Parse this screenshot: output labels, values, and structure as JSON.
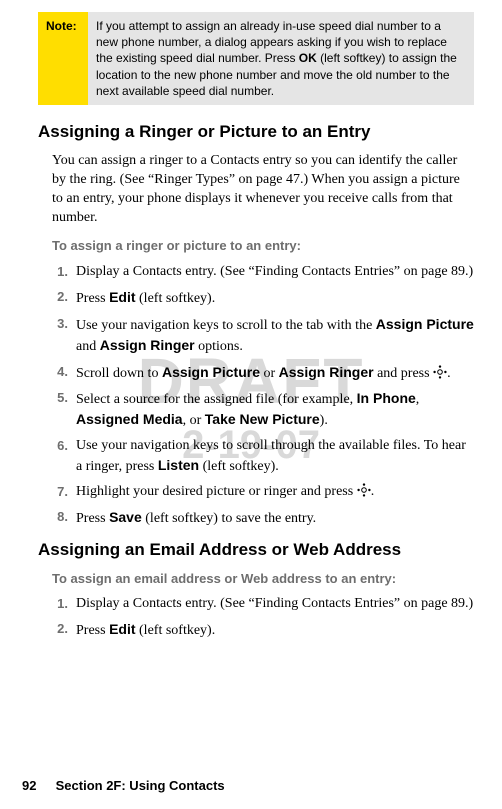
{
  "watermark": {
    "line1": "DRAFT",
    "line2": "2-19-07"
  },
  "note": {
    "label": "Note:",
    "body_pre": "If you attempt to assign an already in-use speed dial number to a new phone number, a dialog appears asking if you wish to replace the existing speed dial number. Press ",
    "ok": "OK",
    "body_post": " (left softkey) to assign the location to the new phone number and move the old number to the next available speed dial number."
  },
  "section1": {
    "heading": "Assigning a Ringer or Picture to an Entry",
    "intro": "You can assign a ringer to a Contacts entry so you can identify the caller by the ring. (See “Ringer Types” on page 47.) When you assign a picture to an entry, your phone displays it whenever you receive calls from that number.",
    "subhead": "To assign a ringer or picture to an entry:",
    "steps": {
      "s1": "Display a Contacts entry. (See “Finding Contacts Entries” on page 89.)",
      "s2_pre": "Press ",
      "s2_b": "Edit",
      "s2_post": " (left softkey).",
      "s3_pre": "Use your navigation keys to scroll to the tab with the ",
      "s3_b1": "Assign Picture",
      "s3_mid": " and ",
      "s3_b2": "Assign Ringer",
      "s3_post": " options.",
      "s4_pre": "Scroll down to ",
      "s4_b1": "Assign Picture",
      "s4_mid": " or ",
      "s4_b2": "Assign Ringer",
      "s4_post1": " and press ",
      "s4_post2": ".",
      "s5_pre": "Select a source for the assigned file (for example, ",
      "s5_b1": "In Phone",
      "s5_c1": ", ",
      "s5_b2": "Assigned Media",
      "s5_c2": ", or ",
      "s5_b3": "Take New Picture",
      "s5_post": ").",
      "s6_pre": "Use your navigation keys to scroll through the available files. To hear a ringer, press ",
      "s6_b": "Listen",
      "s6_post": " (left softkey).",
      "s7_pre": "Highlight your desired picture or ringer and press ",
      "s7_post": ".",
      "s8_pre": "Press ",
      "s8_b": "Save",
      "s8_post": " (left softkey) to save the entry."
    }
  },
  "section2": {
    "heading": "Assigning an Email Address or Web Address",
    "subhead": "To assign an email address or Web address to an entry:",
    "steps": {
      "s1": "Display a Contacts entry. (See “Finding Contacts Entries” on page 89.)",
      "s2_pre": "Press ",
      "s2_b": "Edit",
      "s2_post": " (left softkey)."
    }
  },
  "footer": {
    "page": "92",
    "section": "Section 2F: Using Contacts"
  }
}
